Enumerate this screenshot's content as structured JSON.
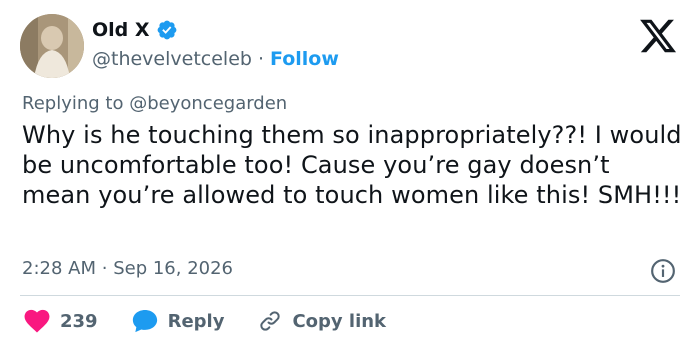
{
  "author": {
    "display_name": "Old X",
    "handle": "@thevelvetceleb",
    "separator": "·",
    "follow_label": "Follow"
  },
  "reply": {
    "prefix": "Replying to",
    "mention": "@beyoncegarden"
  },
  "tweet": {
    "text": "Why is he touching them so inappropriately??! I would be uncomfortable too! Cause you’re gay doesn’t mean you’re allowed to touch women like this! SMH!!!",
    "time": "2:28 AM",
    "meta_separator": "·",
    "date": "Sep 16, 2026"
  },
  "actions": {
    "likes": "239",
    "reply_label": "Reply",
    "copy_label": "Copy link"
  },
  "colors": {
    "accent": "#1d9bf0",
    "like": "#f91880",
    "muted": "#536471",
    "text": "#0f1419"
  },
  "icons": [
    "verified-badge-icon",
    "x-logo-icon",
    "info-icon",
    "heart-icon",
    "reply-bubble-icon",
    "link-icon"
  ]
}
